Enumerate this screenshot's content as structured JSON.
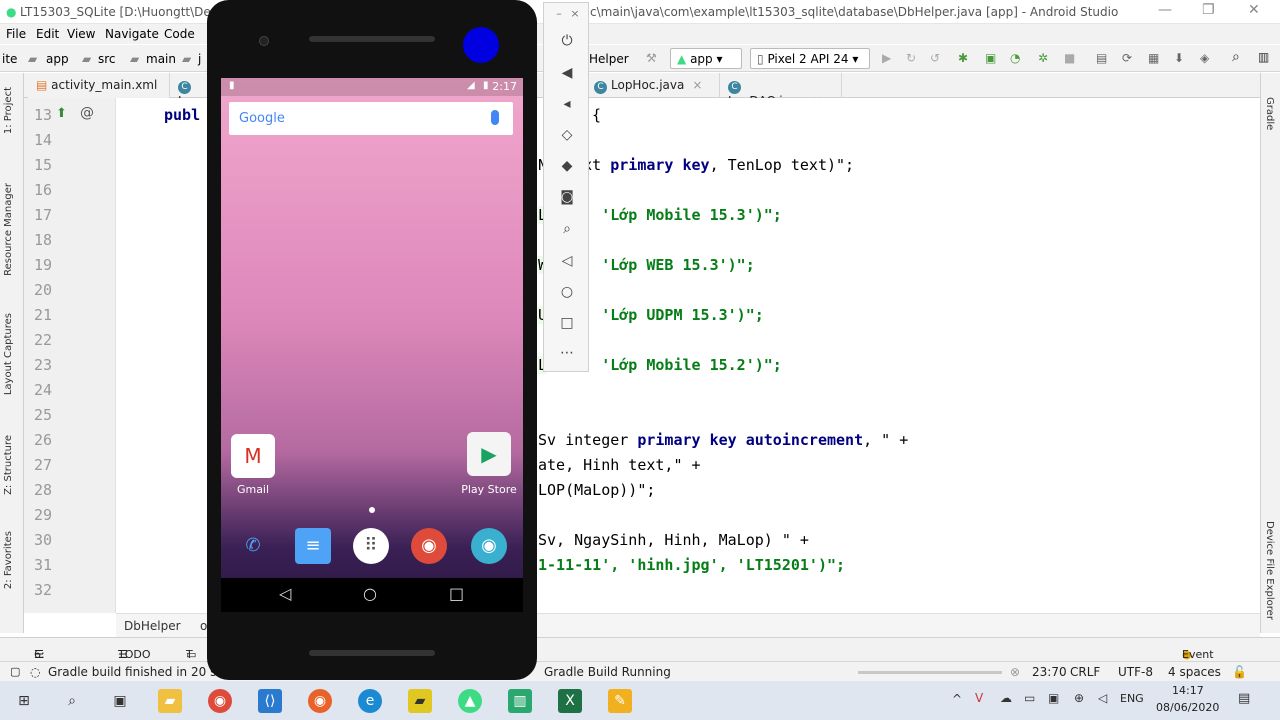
{
  "window": {
    "title": "LT15303_SQLite [D:\\Huongtt\\Demo",
    "title_rest": "c\\main\\java\\com\\example\\lt15303_sqlite\\database\\DbHelper.java [app] - Android Studio"
  },
  "menu": [
    "File",
    "Edit",
    "View",
    "Navigate",
    "Code"
  ],
  "nav": {
    "crumbs": [
      "ite",
      "app",
      "src",
      "main",
      "j"
    ],
    "helper": "Helper",
    "run_config": "app",
    "device": "Pixel 2 API 24"
  },
  "tabs": [
    {
      "label": "activity_main.xml"
    },
    {
      "label": "Lop"
    },
    {
      "label": "LopHoc.java"
    },
    {
      "label": "LopDAO.java"
    }
  ],
  "left_strip": [
    "1: Project",
    "Resource Manager",
    "Layout Captures",
    "Z: Structure",
    "2: Favorites"
  ],
  "right_strip": [
    "Gradle",
    "Device File Explorer"
  ],
  "gutter": {
    "lines": [
      "13",
      "14",
      "15",
      "16",
      "17",
      "18",
      "19",
      "20",
      "21",
      "22",
      "23",
      "24",
      "25",
      "26",
      "27",
      "28",
      "29",
      "30",
      "31",
      "32"
    ]
  },
  "code": {
    "l13a": "publ",
    "l13b": "{",
    "l15a": "N",
    "l15b": "  text ",
    "l15c": "primary key",
    "l15d": ", TenLop text)\";",
    "l17a": "L",
    "l17b": "303', 'Lớp Mobile 15.3')\";",
    "l19a": "W",
    "l19b": "303', 'Lớp WEB 15.3')\";",
    "l21a": "U",
    "l21b": "303', 'Lớp UDPM 15.3')\";",
    "l23a": "L",
    "l23b": "201', 'Lớp Mobile 15.2')\";",
    "l26a": "Sv integer ",
    "l26b": "primary key autoincrement",
    "l26c": ", \" +",
    "l27a": "ate, Hinh text,\" +",
    "l28a": "LOP(MaLop))\";",
    "l30a": "Sv, NgaySinh, Hinh, MaLop) \" +",
    "l31a": "1-11-11', 'hinh.jpg', 'LT15201')\";"
  },
  "editor_breadcrumb": [
    "DbHelper",
    "o"
  ],
  "bottom_tools": [
    "6: Logcat",
    "TODO",
    "T",
    "Gradle Build Running",
    "Event Log"
  ],
  "status": {
    "message": "Gradle build finished in 20 s 86",
    "position": "23:70",
    "line_sep": "CRLF",
    "encoding": "UTF-8",
    "indent": "4 spaces"
  },
  "phone": {
    "time": "2:17",
    "search_logo": "Google",
    "apps": [
      {
        "label": "Gmail"
      },
      {
        "label": "Play Store"
      }
    ]
  },
  "taskbar": {
    "lang": "ENG",
    "time": "14:17",
    "date": "08/06/2020"
  },
  "colors": {
    "keyword": "#000080",
    "string": "#067d17",
    "accent": "#3e86a0"
  }
}
